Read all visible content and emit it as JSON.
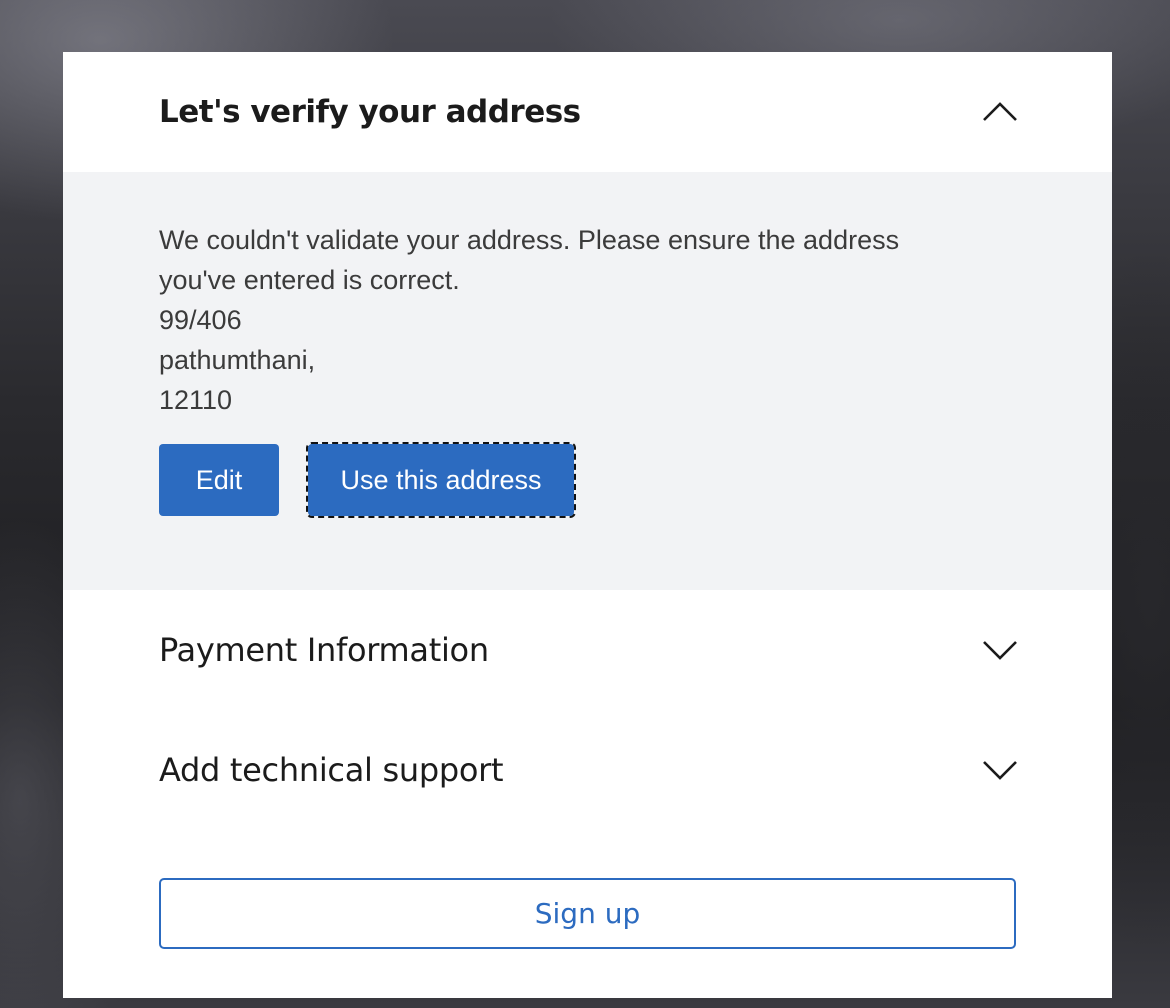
{
  "colors": {
    "accent": "#2c6bc0",
    "panel_background": "#ffffff",
    "expanded_section_background": "#f2f3f5",
    "title_text": "#1b1b1b",
    "body_text": "#3b3b3b"
  },
  "verify_section": {
    "title": "Let's verify your address",
    "expanded": true,
    "toggle_icon": "chevron-up-icon",
    "message_lines": [
      "We couldn't validate your address. Please ensure the address",
      "you've entered is correct."
    ],
    "address_lines": [
      "99/406",
      "pathumthani,",
      "12110"
    ],
    "edit_label": "Edit",
    "use_address_label": "Use this address"
  },
  "payment_section": {
    "title": "Payment Information",
    "expanded": false,
    "toggle_icon": "chevron-down-icon"
  },
  "support_section": {
    "title": "Add technical support",
    "expanded": false,
    "toggle_icon": "chevron-down-icon"
  },
  "signup_label": "Sign up"
}
